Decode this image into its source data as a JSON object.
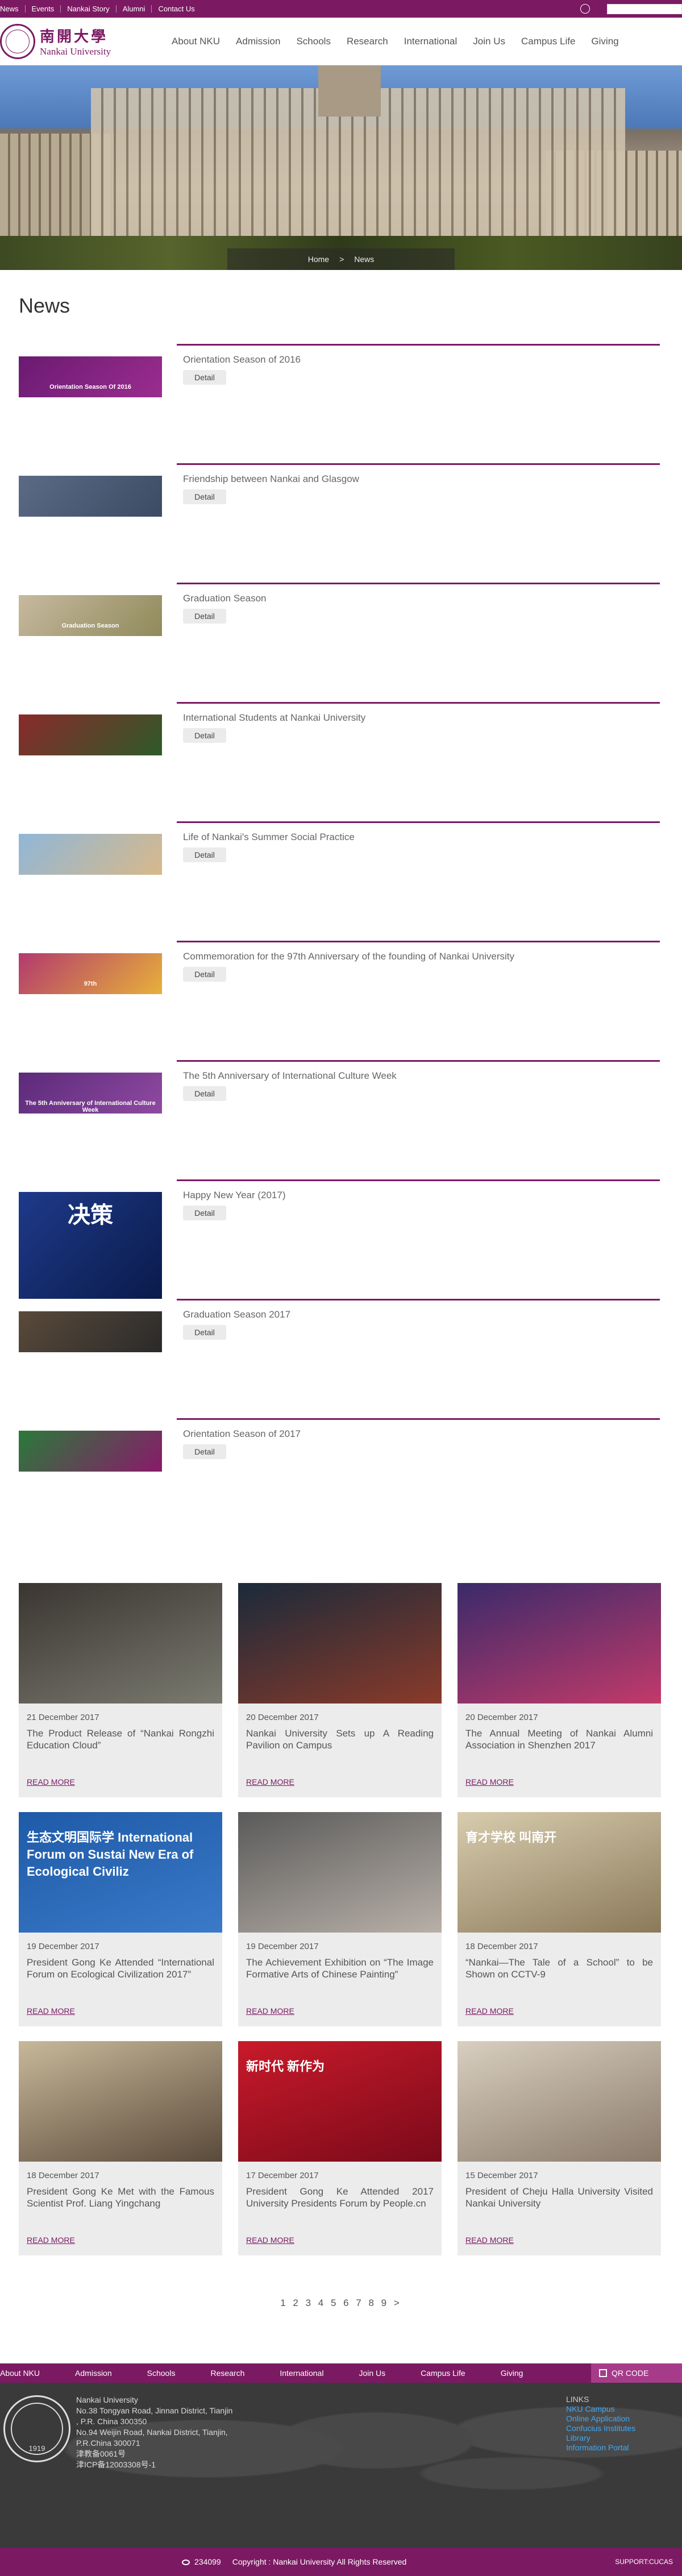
{
  "topbar": {
    "links": [
      "News",
      "Events",
      "Nankai Story",
      "Alumni",
      "Contact Us"
    ],
    "globe_icon": "globe-icon",
    "search_icon": "search-icon"
  },
  "header": {
    "logo_cn": "南開大學",
    "logo_en": "Nankai University",
    "nav": [
      "About NKU",
      "Admission",
      "Schools",
      "Research",
      "International",
      "Join Us",
      "Campus Life",
      "Giving"
    ]
  },
  "breadcrumb": {
    "home": "Home",
    "sep": ">",
    "current": "News"
  },
  "page_title": "News",
  "news_list": [
    {
      "title": "Orientation Season of 2016",
      "detail": "Detail",
      "thumb_text": "Orientation Season Of 2016",
      "colors": [
        "#6a1a72",
        "#9b2d8f"
      ]
    },
    {
      "title": "Friendship between Nankai and Glasgow",
      "detail": "Detail",
      "thumb_text": "",
      "colors": [
        "#5b6b86",
        "#3c4b63"
      ]
    },
    {
      "title": "Graduation Season",
      "detail": "Detail",
      "thumb_text": "Graduation Season",
      "colors": [
        "#c7b9a0",
        "#8f8a5a"
      ]
    },
    {
      "title": "International Students at Nankai University",
      "detail": "Detail",
      "thumb_text": "",
      "colors": [
        "#8a2a2a",
        "#2e5a2a"
      ]
    },
    {
      "title": "Life of Nankai's Summer Social Practice",
      "detail": "Detail",
      "thumb_text": "",
      "colors": [
        "#8fb7d8",
        "#d8b88a"
      ]
    },
    {
      "title": "Commemoration for the 97th Anniversary of the founding of Nankai University",
      "detail": "Detail",
      "thumb_text": "97th",
      "colors": [
        "#b23a6e",
        "#e7b03a"
      ]
    },
    {
      "title": "The 5th Anniversary of International Culture Week",
      "detail": "Detail",
      "thumb_text": "The 5th Anniversary of International Culture Week",
      "colors": [
        "#5c2a7a",
        "#8e4aa0"
      ]
    },
    {
      "title": "Happy New Year (2017)",
      "detail": "Detail",
      "thumb_text": "决策",
      "colors": [
        "#1e3a8a",
        "#0a1a4a"
      ]
    },
    {
      "title": "Graduation Season 2017",
      "detail": "Detail",
      "thumb_text": "",
      "colors": [
        "#5a4a3a",
        "#2a2a2a"
      ]
    },
    {
      "title": "Orientation Season of 2017",
      "detail": "Detail",
      "thumb_text": "",
      "colors": [
        "#2a7a3a",
        "#8a1a6a"
      ]
    }
  ],
  "cards": [
    {
      "date": "21 December 2017",
      "title": "The Product Release of “Nankai Rongzhi Education Cloud”",
      "more": "READ MORE",
      "colors": [
        "#3a3530",
        "#7a7a70"
      ]
    },
    {
      "date": "20 December 2017",
      "title": "Nankai University Sets up A Reading Pavilion on Campus",
      "more": "READ MORE",
      "colors": [
        "#1a2a3a",
        "#8a3a2a"
      ]
    },
    {
      "date": "20 December 2017",
      "title": "The Annual Meeting of Nankai Alumni Association in Shenzhen 2017",
      "more": "READ MORE",
      "colors": [
        "#3a2a6a",
        "#c23a6a"
      ]
    },
    {
      "date": "19 December 2017",
      "title": "President Gong Ke Attended “International Forum on Ecological Civilization 2017”",
      "more": "READ MORE",
      "colors": [
        "#1e5aa8",
        "#3a7ac8"
      ],
      "overlay": "生态文明国际学 International Forum on Sustai New Era of Ecological Civiliz"
    },
    {
      "date": "19 December 2017",
      "title": "The Achievement Exhibition on “The Image Formative Arts of Chinese Painting”",
      "more": "READ MORE",
      "colors": [
        "#5a5a5a",
        "#b8b0a8"
      ]
    },
    {
      "date": "18 December 2017",
      "title": "“Nankai—The Tale of a School” to be Shown on CCTV-9",
      "more": "READ MORE",
      "colors": [
        "#d8ccae",
        "#8a7a5a"
      ],
      "overlay": "育才学校 叫南开"
    },
    {
      "date": "18 December 2017",
      "title": "President Gong Ke Met with the Famous Scientist Prof. Liang Yingchang",
      "more": "READ MORE",
      "colors": [
        "#c8b89a",
        "#5a4a3a"
      ]
    },
    {
      "date": "17 December 2017",
      "title": "President Gong Ke Attended 2017 University Presidents Forum by People.cn",
      "more": "READ MORE",
      "colors": [
        "#c81a2a",
        "#7a0a1a"
      ],
      "overlay": "新时代 新作为"
    },
    {
      "date": "15 December 2017",
      "title": "President of Cheju Halla University Visited Nankai University",
      "more": "READ MORE",
      "colors": [
        "#d8cfc0",
        "#8a7a6a"
      ]
    }
  ],
  "pagination": "1 2 3 4 5 6 7 8 9 >",
  "footer_nav": {
    "items": [
      "About NKU",
      "Admission",
      "Schools",
      "Research",
      "International",
      "Join Us",
      "Campus Life",
      "Giving"
    ],
    "qr": "QR CODE"
  },
  "footer": {
    "seal_year": "1919",
    "address": [
      "Nankai University",
      "No.38 Tongyan Road, Jinnan District, Tianjin",
      ", P.R. China 300350",
      "No.94 Weijin Road, Nankai District, Tianjin,",
      "P.R.China 300071",
      "津教备0061号",
      "津ICP备12003308号-1"
    ],
    "links_title": "LINKS",
    "links": [
      "NKU Campus",
      "Online Application",
      "Confucius Institutes",
      "Library",
      "Information Portal"
    ]
  },
  "copyright": {
    "visits": "234099",
    "text": "Copyright : Nankai University All Rights Reserved",
    "support": "SUPPORT:CUCAS"
  }
}
